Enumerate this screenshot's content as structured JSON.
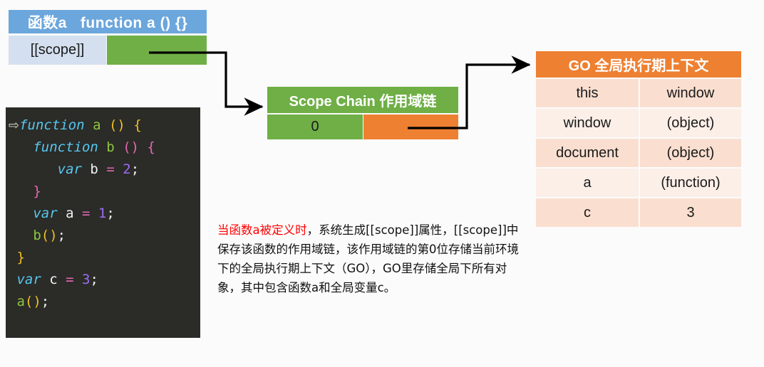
{
  "colors": {
    "page_background": "#eaeaea",
    "canvas_background": "#fbfbfb",
    "blue_header": "#6ba6dc",
    "light_blue_cell": "#d4e0f0",
    "green": "#6faf46",
    "orange": "#ee8032",
    "table_row_dark": "#fadfd0",
    "table_row_light": "#fcefe8",
    "code_background": "#2b2b28",
    "highlight_red": "#ff0000",
    "connector_line": "#000000"
  },
  "function_panel": {
    "header": "函数a   function a () {}",
    "scope_label": "[[scope]]",
    "scope_value": ""
  },
  "code_block": {
    "cursor_glyph": "⇨",
    "lines": [
      "function a () {",
      "  function b () {",
      "    var b = 2;",
      "  }",
      "  var a = 1;",
      "  b();",
      "}",
      "var c = 3;",
      "a();"
    ]
  },
  "scope_chain": {
    "header": "Scope Chain 作用域链",
    "index_label": "0",
    "value_label": ""
  },
  "go_table": {
    "header": "GO 全局执行期上下文",
    "rows": [
      {
        "key": "this",
        "value": "window"
      },
      {
        "key": "window",
        "value": "(object)"
      },
      {
        "key": "document",
        "value": "(object)"
      },
      {
        "key": "a",
        "value": "(function)"
      },
      {
        "key": "c",
        "value": "3"
      }
    ]
  },
  "explanation": {
    "highlight": "当函数a被定义时",
    "rest": "，系统生成[[scope]]属性，[[scope]]中保存该函数的作用域链，该作用域链的第0位存储当前环境下的全局执行期上下文（GO），GO里存储全局下所有对象，其中包含函数a和全局变量c。"
  }
}
